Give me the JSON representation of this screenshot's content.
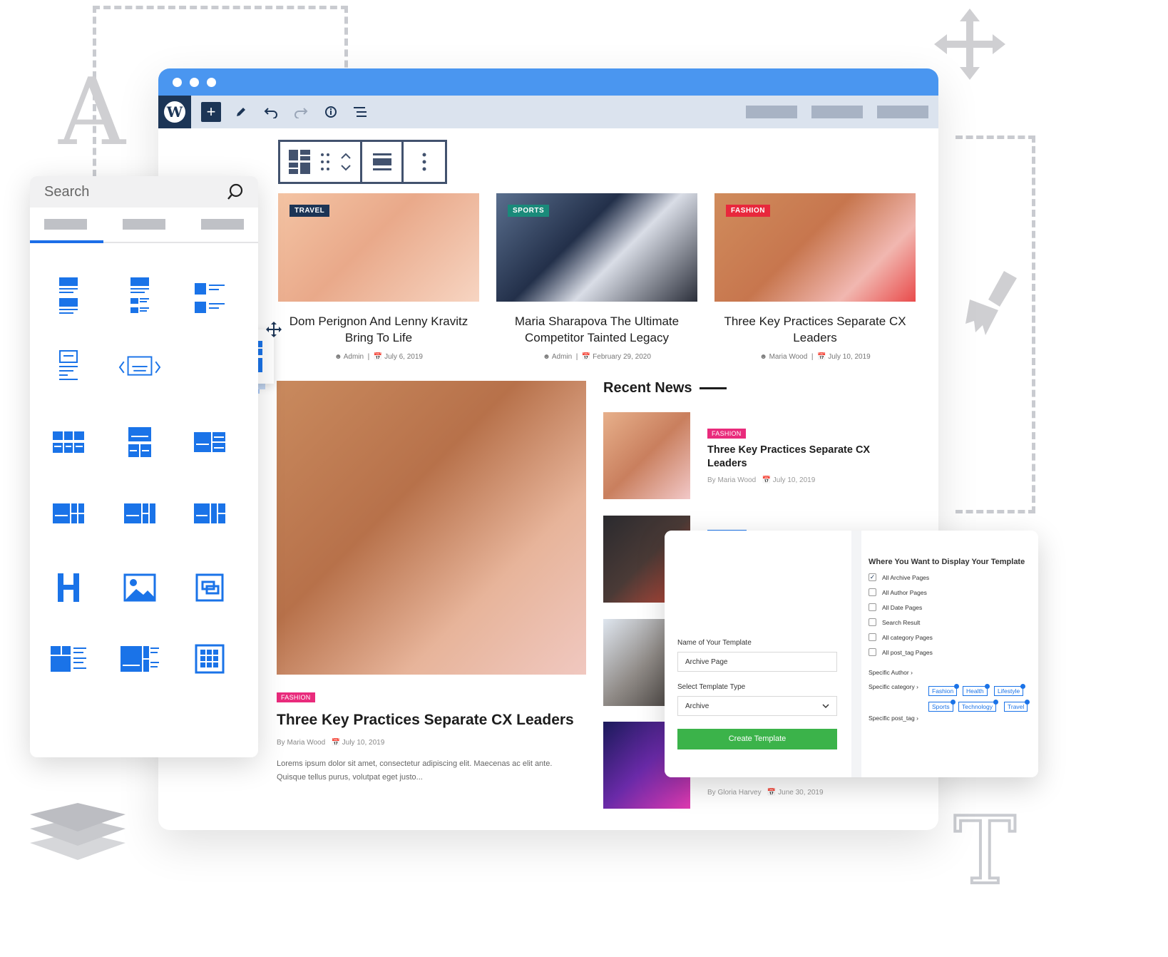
{
  "colors": {
    "accent": "#4a96f0",
    "wp_dark": "#1c3556",
    "blue_icon": "#1a73e8",
    "green_button": "#3bb34a"
  },
  "editor": {
    "toolbar": {
      "add_icon": "plus-icon",
      "tools": [
        "edit-pencil-icon",
        "undo-icon",
        "redo-icon",
        "info-icon",
        "list-view-icon"
      ]
    },
    "block_toolbar": {
      "icons": [
        "grid-block-icon",
        "drag-handle-icon",
        "move-up-down-icon",
        "align-icon",
        "more-options-icon"
      ]
    }
  },
  "posts": [
    {
      "badge": "TRAVEL",
      "badge_color": "#1c3556",
      "title": "Dom Perignon And Lenny Kravitz Bring To Life",
      "author": "Admin",
      "date": "July 6, 2019"
    },
    {
      "badge": "SPORTS",
      "badge_color": "#1a8a7a",
      "title": "Maria Sharapova The Ultimate Competitor Tainted Legacy",
      "author": "Admin",
      "date": "February 29, 2020"
    },
    {
      "badge": "FASHION",
      "badge_color": "#e8283c",
      "title": "Three Key Practices Separate CX Leaders",
      "author": "Maria Wood",
      "date": "July 10, 2019"
    }
  ],
  "featured": {
    "badge": "FASHION",
    "title": "Three Key Practices Separate CX Leaders",
    "author": "By Maria Wood",
    "date": "July 10, 2019",
    "excerpt": "Lorems ipsum dolor sit amet, consectetur adipiscing elit. Maecenas ac elit ante. Quisque tellus purus, volutpat eget justo..."
  },
  "recent": {
    "heading": "Recent News",
    "items": [
      {
        "badge": "FASHION",
        "title": "Three Key Practices Separate CX Leaders",
        "author": "By Maria Wood",
        "date": "July 10, 2019"
      },
      {
        "author": "By Gloria Harvey",
        "date": "June 30, 2019"
      }
    ]
  },
  "sidebar": {
    "search_placeholder": "Search",
    "search_icon": "search-icon"
  },
  "dialog": {
    "name_label": "Name of Your Template",
    "name_value": "Archive Page",
    "type_label": "Select Template Type",
    "type_value": "Archive",
    "create_label": "Create Template",
    "display_title": "Where You Want to Display Your Template",
    "options": [
      {
        "label": "All Archive Pages",
        "checked": true
      },
      {
        "label": "All Author Pages",
        "checked": false
      },
      {
        "label": "All Date Pages",
        "checked": false
      },
      {
        "label": "Search Result",
        "checked": false
      },
      {
        "label": "All category Pages",
        "checked": false
      },
      {
        "label": "All post_tag Pages",
        "checked": false
      }
    ],
    "specific_author": "Specific Author",
    "specific_category": "Specific category",
    "specific_post_tag": "Specific post_tag",
    "tags": [
      "Fashion",
      "Health",
      "Lifestyle",
      "Sports",
      "Technology",
      "Travel"
    ]
  },
  "decorations": {
    "letter_a": "A",
    "letter_t": "T",
    "icons": [
      "move-arrows-icon",
      "paint-brush-icon",
      "layers-icon"
    ]
  }
}
